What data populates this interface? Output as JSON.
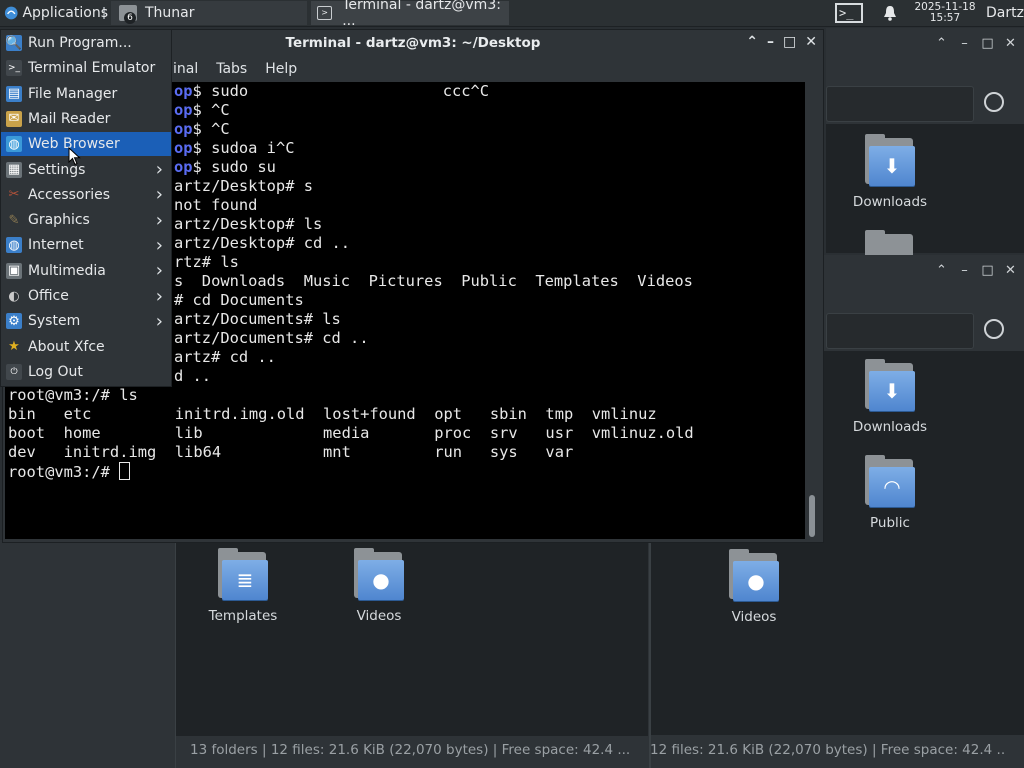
{
  "taskbar": {
    "apps_label": "Applications",
    "thunar_label": "Thunar",
    "thunar_count": "6",
    "terminal_label": "Terminal - dartz@vm3: ...",
    "date": "2025-11-18",
    "time": "15:57",
    "user": "Dartz"
  },
  "terminal": {
    "title": "Terminal - dartz@vm3: ~/Desktop",
    "menus": [
      "inal",
      "Tabs",
      "Help"
    ],
    "lines": [
      {
        "blue": "op",
        "text": "$ sudo                     ccc^C"
      },
      {
        "blue": "op",
        "text": "$ ^C"
      },
      {
        "blue": "op",
        "text": "$ ^C"
      },
      {
        "blue": "op",
        "text": "$ sudoa i^C"
      },
      {
        "blue": "op",
        "text": "$ sudo su"
      },
      {
        "blue": "",
        "text": "artz/Desktop# s"
      },
      {
        "blue": "",
        "text": "not found"
      },
      {
        "blue": "",
        "text": "artz/Desktop# ls"
      },
      {
        "blue": "",
        "text": "artz/Desktop# cd .."
      },
      {
        "blue": "",
        "text": "rtz# ls"
      },
      {
        "blue": "",
        "text": "s  Downloads  Music  Pictures  Public  Templates  Videos"
      },
      {
        "blue": "",
        "text": "# cd Documents"
      },
      {
        "blue": "",
        "text": "artz/Documents# ls"
      },
      {
        "blue": "",
        "text": "artz/Documents# cd .."
      },
      {
        "blue": "",
        "text": "artz# cd .."
      },
      {
        "blue": "",
        "text": "d .."
      }
    ],
    "lower_lines": [
      "root@vm3:/# ls",
      "bin   etc         initrd.img.old  lost+found  opt   sbin  tmp  vmlinuz",
      "boot  home        lib             media       proc  srv   usr  vmlinuz.old",
      "dev   initrd.img  lib64           mnt         run   sys   var",
      "root@vm3:/# "
    ]
  },
  "app_menu": {
    "items": [
      {
        "label": "Run Program...",
        "icon": "search-icon",
        "submenu": false
      },
      {
        "label": "Terminal Emulator",
        "icon": "terminal-icon",
        "submenu": false
      },
      {
        "label": "File Manager",
        "icon": "file-manager-icon",
        "submenu": false
      },
      {
        "label": "Mail Reader",
        "icon": "mail-icon",
        "submenu": false
      },
      {
        "label": "Web Browser",
        "icon": "globe-icon",
        "submenu": false,
        "selected": true
      },
      {
        "label": "Settings",
        "icon": "settings-icon",
        "submenu": true
      },
      {
        "label": "Accessories",
        "icon": "accessories-icon",
        "submenu": true
      },
      {
        "label": "Graphics",
        "icon": "graphics-icon",
        "submenu": true
      },
      {
        "label": "Internet",
        "icon": "internet-icon",
        "submenu": true
      },
      {
        "label": "Multimedia",
        "icon": "multimedia-icon",
        "submenu": true
      },
      {
        "label": "Office",
        "icon": "office-icon",
        "submenu": true
      },
      {
        "label": "System",
        "icon": "system-icon",
        "submenu": true
      },
      {
        "label": "About Xfce",
        "icon": "star-icon",
        "submenu": false
      },
      {
        "label": "Log Out",
        "icon": "logout-icon",
        "submenu": false
      }
    ]
  },
  "file_manager": {
    "folders_left": [
      "Templates",
      "Videos"
    ],
    "folders_right_a": [
      "Downloads"
    ],
    "folders_right_b": [
      "Downloads",
      "Public"
    ],
    "folders_bottom_right": [
      "Videos"
    ],
    "status_left": "13 folders  |  12 files: 21.6 KiB (22,070 bytes)  |  Free space: 42.4 ...",
    "status_right": "12 files: 21.6 KiB (22,070 bytes)  |  Free space: 42.4 ..."
  }
}
